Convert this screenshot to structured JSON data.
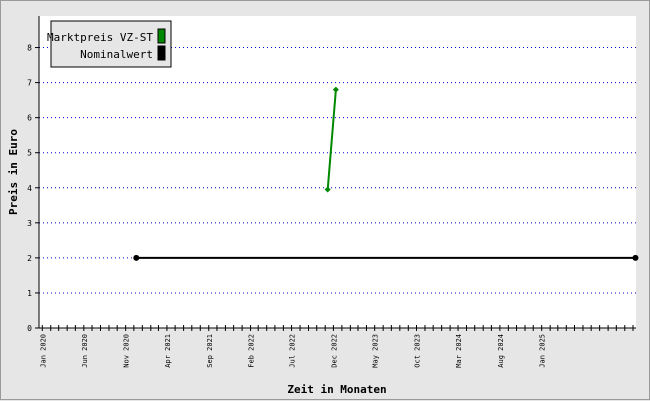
{
  "chart_data": {
    "type": "line",
    "xlabel": "Zeit in Monaten",
    "ylabel": "Preis in Euro",
    "x_range": [
      "2019-12-20",
      "2025-12-12"
    ],
    "ylim": [
      0,
      8.9
    ],
    "yticks": [
      0,
      1,
      2,
      3,
      4,
      5,
      6,
      7,
      8
    ],
    "grid": {
      "horizontal": true,
      "style": "dotted",
      "color": "#0000cc"
    },
    "xtick_labels": [
      {
        "date": "2020-01-01",
        "label": "Jan 2020"
      },
      {
        "date": "2020-06-01",
        "label": "Jun 2020"
      },
      {
        "date": "2020-11-01",
        "label": "Nov 2020"
      },
      {
        "date": "2021-04-01",
        "label": "Apr 2021"
      },
      {
        "date": "2021-09-01",
        "label": "Sep 2021"
      },
      {
        "date": "2022-02-01",
        "label": "Feb 2022"
      },
      {
        "date": "2022-07-01",
        "label": "Jul 2022"
      },
      {
        "date": "2022-12-01",
        "label": "Dec 2022"
      },
      {
        "date": "2023-05-01",
        "label": "May 2023"
      },
      {
        "date": "2023-10-01",
        "label": "Oct 2023"
      },
      {
        "date": "2024-03-01",
        "label": "Mar 2024"
      },
      {
        "date": "2024-08-01",
        "label": "Aug 2024"
      },
      {
        "date": "2025-01-01",
        "label": "Jan 2025"
      }
    ],
    "legend_position": "top-left",
    "series": [
      {
        "name": "Marktpreis VZ-ST",
        "color": "#008800",
        "points": [
          {
            "date": "2022-11-10",
            "value": 3.95
          },
          {
            "date": "2022-12-10",
            "value": 6.8
          }
        ]
      },
      {
        "name": "Nominalwert",
        "color": "#000000",
        "points": [
          {
            "date": "2020-12-10",
            "value": 2.0
          },
          {
            "date": "2025-12-10",
            "value": 2.0
          }
        ]
      }
    ]
  }
}
